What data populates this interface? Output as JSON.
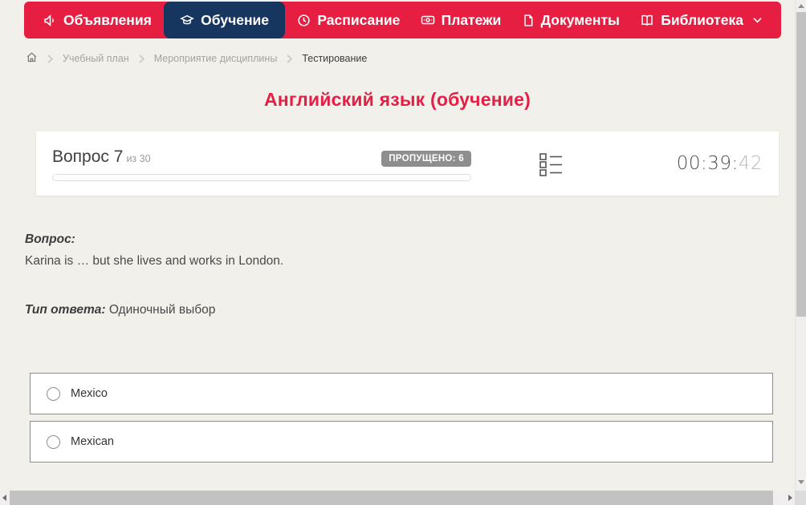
{
  "nav": {
    "items": [
      {
        "label": "Объявления",
        "icon": "megaphone-icon",
        "active": false
      },
      {
        "label": "Обучение",
        "icon": "graduation-cap-icon",
        "active": true
      },
      {
        "label": "Расписание",
        "icon": "clock-icon",
        "active": false
      },
      {
        "label": "Платежи",
        "icon": "cash-icon",
        "active": false
      },
      {
        "label": "Документы",
        "icon": "document-icon",
        "active": false
      },
      {
        "label": "Библиотека",
        "icon": "book-icon",
        "active": false,
        "has_dropdown": true
      }
    ],
    "colors": {
      "bar": "#e61e41",
      "active_item": "#16365f",
      "text": "#ffffff"
    }
  },
  "breadcrumb": {
    "items": [
      "Учебный план",
      "Мероприятие дисциплины",
      "Тестирование"
    ]
  },
  "page": {
    "title": "Английский язык (обучение)",
    "title_color": "#e61e45",
    "background_color": "#f2f0ea"
  },
  "question_panel": {
    "question_label": "Вопрос 7",
    "question_total": "из 30",
    "skipped_badge": "ПРОПУЩЕНО: 6",
    "badge_color": "#8e8e8e",
    "progress_percent": 0,
    "timer": {
      "main": "00:39:",
      "seconds": "42"
    }
  },
  "question": {
    "label": "Вопрос:",
    "text": "Karina is … but she lives and works in London.",
    "answer_type_label": "Тип ответа:",
    "answer_type_value": "Одиночный выбор"
  },
  "options": [
    {
      "label": "Mexico",
      "selected": false
    },
    {
      "label": "Mexican",
      "selected": false
    }
  ]
}
